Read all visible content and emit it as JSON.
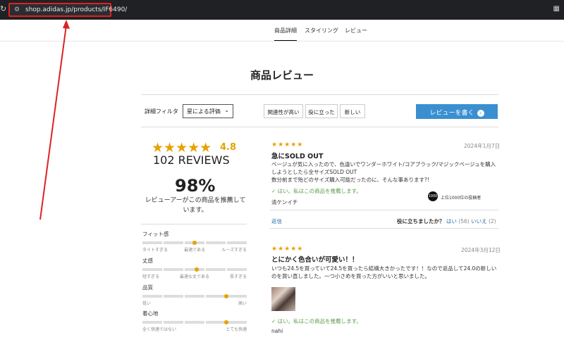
{
  "browser": {
    "url": "shop.adidas.jp/products/IF6490/",
    "reload_icon": "reload-icon",
    "tune_icon": "site-settings-icon",
    "extension_icon": "extensions-icon"
  },
  "tabs": [
    {
      "label": "商品詳細",
      "active": true
    },
    {
      "label": "スタイリング",
      "active": false
    },
    {
      "label": "レビュー",
      "active": false
    }
  ],
  "page_title": "商品レビュー",
  "filters": {
    "label": "詳細フィルタ",
    "select_value": "星による評価",
    "sort_options": [
      "関連性が高い",
      "役に立った",
      "新しい"
    ],
    "write_review": "レビューを書く"
  },
  "summary": {
    "stars": "★★★★★",
    "rating": "4.8",
    "reviews_count": "102 REVIEWS",
    "percent": "98%",
    "recommend_text": "レビューアーがこの商品を推薦しています。",
    "metrics": [
      {
        "title": "フィット感",
        "left": "タイトすぎる",
        "mid": "最適である",
        "right": "ルーズすぎる",
        "value": 0.5
      },
      {
        "title": "丈感",
        "left": "短すぎる",
        "mid": "最適な丈である",
        "right": "長すぎる",
        "value": 0.52
      },
      {
        "title": "品質",
        "left": "低い",
        "mid": "",
        "right": "高い",
        "value": 0.8
      },
      {
        "title": "着心地",
        "left": "全く快適ではない",
        "mid": "",
        "right": "とても快適",
        "value": 0.8
      }
    ]
  },
  "reviews": [
    {
      "stars": "★★★★★",
      "date": "2024年1月7日",
      "title": "急にSOLD OUT",
      "body": "ベージュが気に入ったので、色違いでワンダーホワイト/コアブラック/マジックベージュを購入しようとしたら全サイズSOLD OUT\n数分前まで殆どのサイズ購入可能だったのに、そんな事あります?!",
      "recommend": "✓ はい。私はこの商品を推薦します。",
      "badge_icon": "1000",
      "badge": "上位1000位の投稿者",
      "author": "清ケンイチ",
      "reply": "返信",
      "helpful_q": "役に立ちましたか？",
      "yes": "はい",
      "yes_count": "(56)",
      "no": "いいえ",
      "no_count": "(2)"
    },
    {
      "stars": "★★★★★",
      "date": "2024年3月12日",
      "title": "とにかく色合いが可愛い！！",
      "body": "いつも24.5を買っていて24.5を買ったら結構大きかったです！！なので返品して24.0の新しいのを買い直しました。一つ小さめを買った方がいいと思いました。",
      "recommend": "✓ はい。私はこの商品を推薦します。",
      "author": "nahi"
    }
  ]
}
